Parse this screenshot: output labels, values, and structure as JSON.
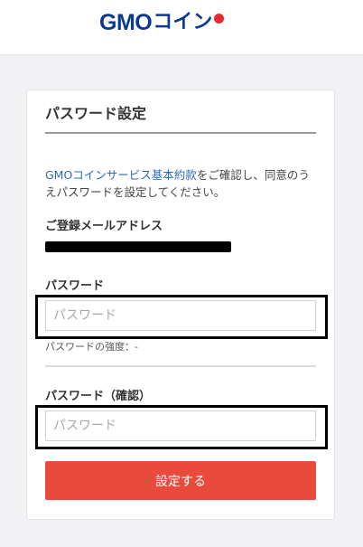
{
  "header": {
    "logo": {
      "latin": "GMO",
      "kana": "コイン",
      "dot_color": "#e8292f",
      "text_color": "#0b3a8f"
    }
  },
  "form": {
    "title": "パスワード設定",
    "notice_link": "GMOコインサービス基本約款",
    "notice_text": "をご確認し、同意のうえパスワードを設定してください。",
    "email_label": "ご登録メールアドレス",
    "email_value": "[redacted]",
    "password_label": "パスワード",
    "password_placeholder": "パスワード",
    "password_value": "",
    "strength_text": "パスワードの強度：-",
    "password_confirm_label": "パスワード（確認）",
    "password_confirm_placeholder": "パスワード",
    "password_confirm_value": "",
    "submit_label": "設定する",
    "submit_color": "#e84b3c"
  }
}
